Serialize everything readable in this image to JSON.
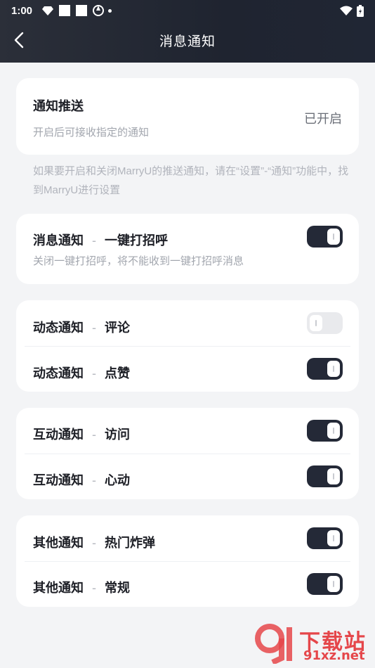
{
  "status_bar": {
    "time": "1:00"
  },
  "nav": {
    "title": "消息通知"
  },
  "push_card": {
    "title": "通知推送",
    "subtitle": "开启后可接收指定的通知",
    "status": "已开启"
  },
  "note": "如果要开启和关闭MarryU的推送通知，请在“设置”-“通知”功能中，找到MarryU进行设置",
  "groups": [
    {
      "items": [
        {
          "category": "消息通知",
          "separator": "-",
          "name": "一键打招呼",
          "subtitle": "关闭一键打招呼，将不能收到一键打招呼消息",
          "enabled": true
        }
      ]
    },
    {
      "items": [
        {
          "category": "动态通知",
          "separator": "-",
          "name": "评论",
          "enabled": false
        },
        {
          "category": "动态通知",
          "separator": "-",
          "name": "点赞",
          "enabled": true
        }
      ]
    },
    {
      "items": [
        {
          "category": "互动通知",
          "separator": "-",
          "name": "访问",
          "enabled": true
        },
        {
          "category": "互动通知",
          "separator": "-",
          "name": "心动",
          "enabled": true
        }
      ]
    },
    {
      "items": [
        {
          "category": "其他通知",
          "separator": "-",
          "name": "热门炸弹",
          "enabled": true
        },
        {
          "category": "其他通知",
          "separator": "-",
          "name": "常规",
          "enabled": true
        }
      ]
    }
  ],
  "watermark": {
    "line1": "下载站",
    "line2": "91xz.net"
  },
  "colors": {
    "header_bg": "#242937",
    "toggle_on": "#242937",
    "toggle_off": "#e9eaed",
    "page_bg": "#f3f4f6"
  }
}
